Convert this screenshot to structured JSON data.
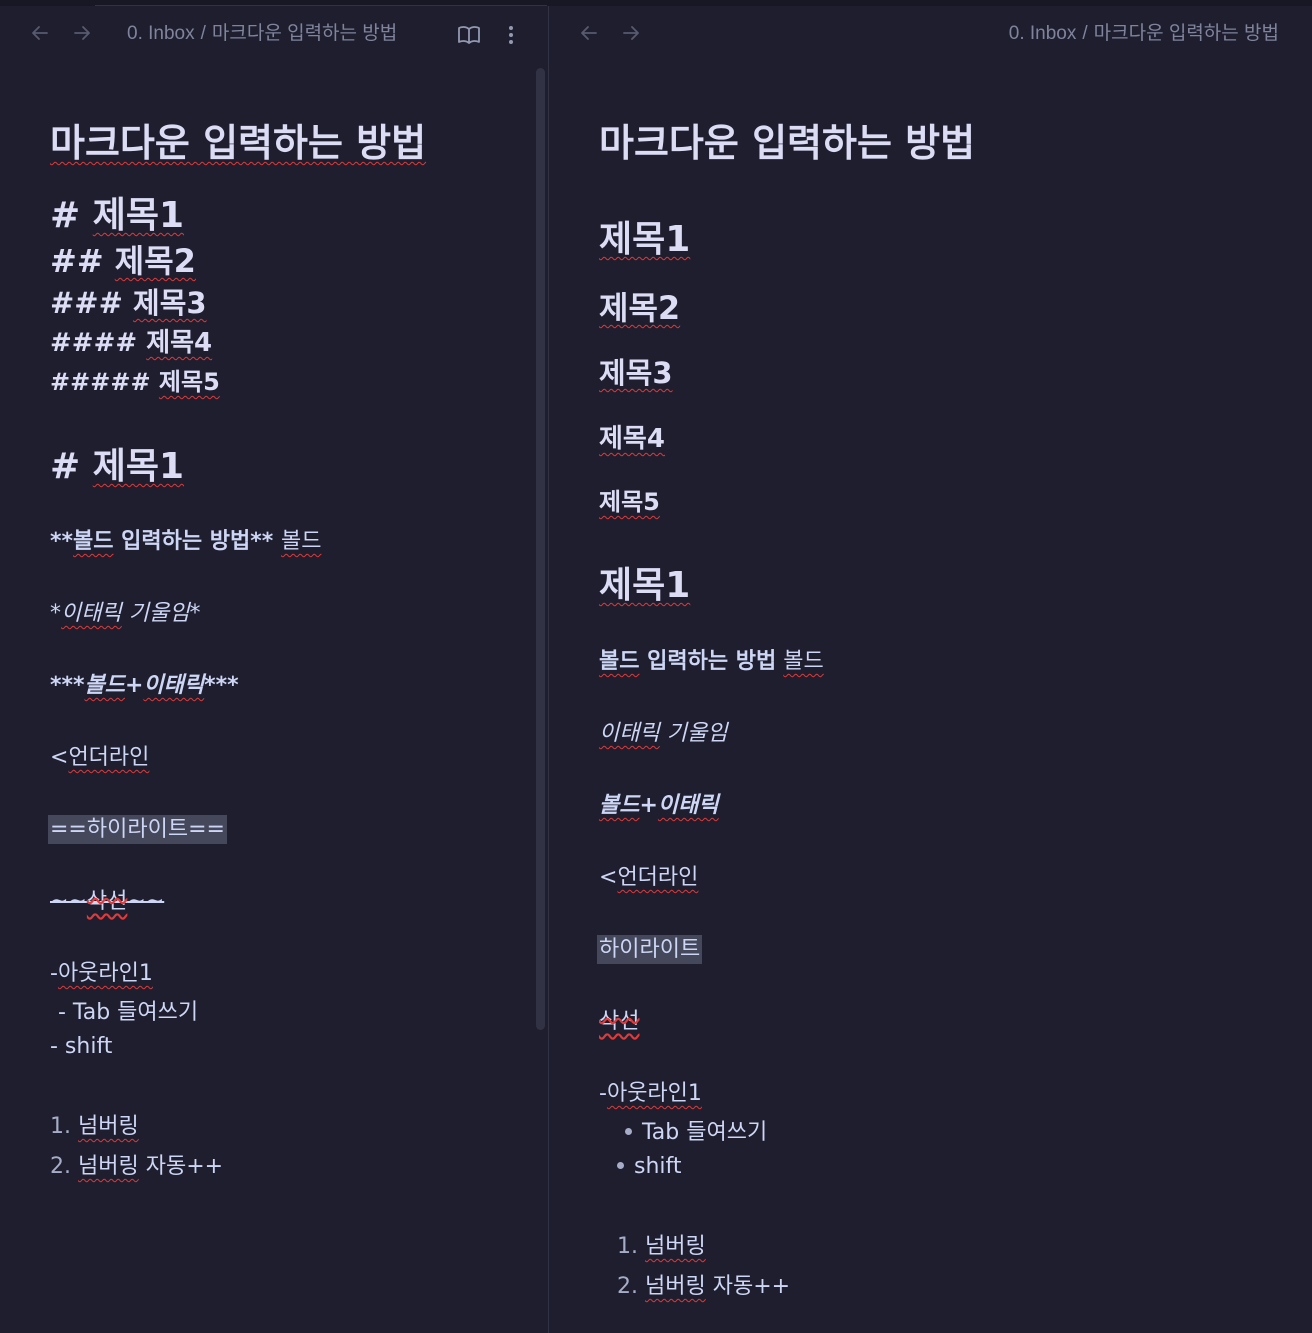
{
  "breadcrumb": {
    "folder": "0. Inbox",
    "separator": "/",
    "note": "마크다운 입력하는 방법"
  },
  "icons": {
    "back": "arrow-left-icon",
    "forward": "arrow-right-icon",
    "reading_view": "book-open-icon",
    "more": "more-vertical-icon"
  },
  "title": "마크다운 입력하는 방법",
  "source": {
    "h1_prefix": "#",
    "h1_text": "제목1",
    "h2_prefix": "##",
    "h2_text": "제목2",
    "h3_prefix": "###",
    "h3_text": "제목3",
    "h4_prefix": "####",
    "h4_text": "제목4",
    "h5_prefix": "#####",
    "h5_text": "제목5",
    "h1b_prefix": "#",
    "h1b_text": "제목1",
    "bold_open": "**",
    "bold_w1": "볼드",
    "bold_rest": "입력하는 방법",
    "bold_close": "**",
    "bold_tail": "볼드",
    "italic_open": "*",
    "italic_w1": "이태릭",
    "italic_rest": "기울임",
    "italic_close": "*",
    "bi_open": "***",
    "bi_w1": "볼드",
    "bi_plus": "+",
    "bi_w2": "이태릭",
    "bi_close": "***",
    "under_open": "<",
    "under_text": "언더라인",
    "highlight": "==하이라이트==",
    "strike_open": "~~",
    "strike_text": "삭선",
    "strike_close": "~~",
    "outline_dash": "-",
    "outline_text": "아웃라인1",
    "tab_line": "- Tab 들여쓰기",
    "shift_line": "- shift",
    "num1_prefix": "1.",
    "num1_text": "넘버링",
    "num2_prefix": "2.",
    "num2_w1": "넘버링",
    "num2_rest": "자동++"
  },
  "preview": {
    "h1": "제목1",
    "h2": "제목2",
    "h3": "제목3",
    "h4": "제목4",
    "h5": "제목5",
    "h1b": "제목1",
    "bold_w1": "볼드",
    "bold_rest": "입력하는 방법",
    "bold_tail": "볼드",
    "italic_w1": "이태릭",
    "italic_rest": "기울임",
    "bi_w1": "볼드",
    "bi_plus": "+",
    "bi_w2": "이태릭",
    "under_open": "<",
    "under_text": "언더라인",
    "highlight": "하이라이트",
    "strike_text": "삭선",
    "outline_dash": "-",
    "outline_text": "아웃라인1",
    "bullet1": "Tab 들여쓰기",
    "bullet2": "shift",
    "num1_prefix": "1.",
    "num1_text": "넘버링",
    "num2_prefix": "2.",
    "num2_w1": "넘버링",
    "num2_rest": "자동++"
  }
}
